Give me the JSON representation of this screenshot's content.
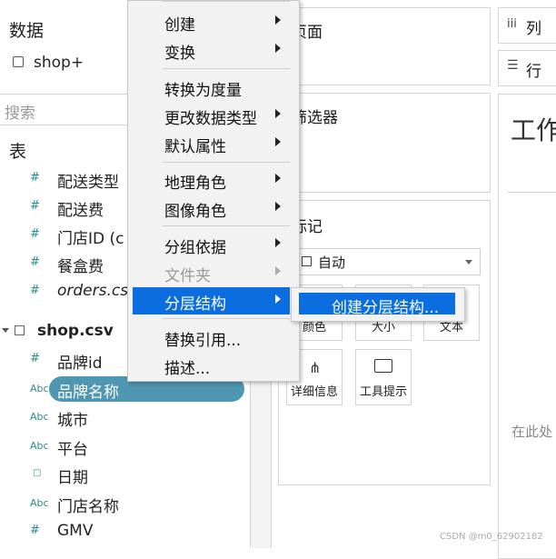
{
  "left_pane": {
    "title": "数据",
    "datasource": "shop+",
    "search_placeholder": "搜索",
    "section": "表",
    "fields_a": [
      {
        "icon": "#",
        "label": "配送类型"
      },
      {
        "icon": "#",
        "label": "配送费"
      },
      {
        "icon": "#",
        "label": "门店ID (c"
      },
      {
        "icon": "#",
        "label": "餐盒费"
      },
      {
        "icon": "#",
        "label": "orders.cs"
      }
    ],
    "table_name": "shop.csv",
    "fields_b": [
      {
        "icon": "#",
        "label": "品牌id"
      },
      {
        "icon": "Abc",
        "label": "品牌名称"
      },
      {
        "icon": "Abc",
        "label": "城市"
      },
      {
        "icon": "Abc",
        "label": "平台"
      },
      {
        "icon": "▢",
        "label": "日期"
      },
      {
        "icon": "Abc",
        "label": "门店名称"
      },
      {
        "icon": "#",
        "label": "GMV"
      }
    ]
  },
  "context_menu": {
    "items": [
      "创建",
      "变换",
      "转换为度量",
      "更改数据类型",
      "默认属性",
      "地理角色",
      "图像角色",
      "分组依据",
      "文件夹",
      "分层结构",
      "替换引用...",
      "描述..."
    ],
    "submenu_item": "创建分层结构..."
  },
  "shelves": {
    "pages": "页面",
    "filters": "筛选器",
    "marks": "标记",
    "mark_type": "自动",
    "cards": [
      "颜色",
      "大小",
      "文本",
      "详细信息",
      "工具提示"
    ],
    "columns": "列",
    "rows": "行",
    "sheet_title": "工作",
    "drop_hint": "在此处"
  },
  "watermark": "CSDN @m0_62902182"
}
